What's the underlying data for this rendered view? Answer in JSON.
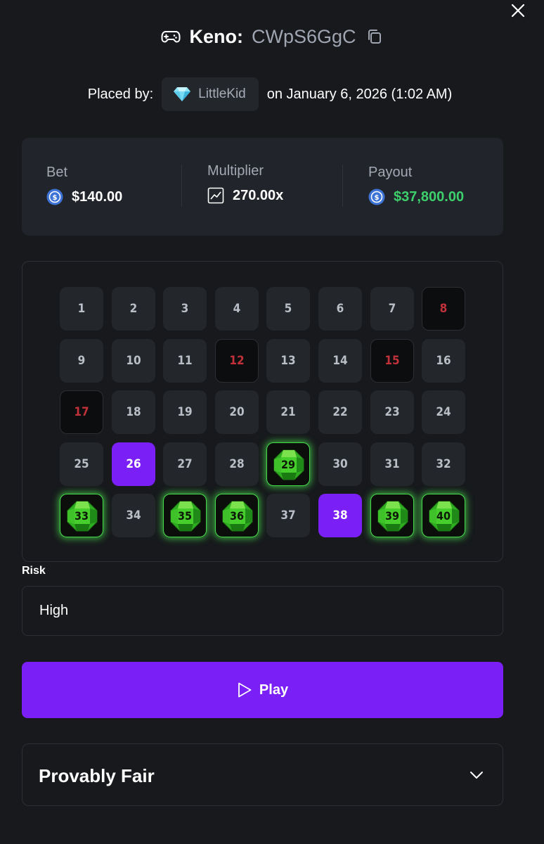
{
  "header": {
    "game_label": "Keno:",
    "bet_id": "CWpS6GgC",
    "game_icon": "gamepad-icon",
    "copy_icon": "copy-icon",
    "close_icon": "close-icon"
  },
  "placed": {
    "label": "Placed by:",
    "user_icon": "diamond-icon",
    "username": "LittleKid",
    "date": "on January 6, 2026 (1:02 AM)"
  },
  "stats": {
    "bet_label": "Bet",
    "bet_value": "$140.00",
    "multiplier_label": "Multiplier",
    "multiplier_value": "270.00x",
    "payout_label": "Payout",
    "payout_value": "$37,800.00",
    "coin_icon": "usd-coin-icon",
    "multiplier_icon": "chart-icon"
  },
  "board": {
    "tiles": [
      {
        "n": "1",
        "state": "normal"
      },
      {
        "n": "2",
        "state": "normal"
      },
      {
        "n": "3",
        "state": "normal"
      },
      {
        "n": "4",
        "state": "normal"
      },
      {
        "n": "5",
        "state": "normal"
      },
      {
        "n": "6",
        "state": "normal"
      },
      {
        "n": "7",
        "state": "normal"
      },
      {
        "n": "8",
        "state": "miss"
      },
      {
        "n": "9",
        "state": "normal"
      },
      {
        "n": "10",
        "state": "normal"
      },
      {
        "n": "11",
        "state": "normal"
      },
      {
        "n": "12",
        "state": "miss"
      },
      {
        "n": "13",
        "state": "normal"
      },
      {
        "n": "14",
        "state": "normal"
      },
      {
        "n": "15",
        "state": "miss"
      },
      {
        "n": "16",
        "state": "normal"
      },
      {
        "n": "17",
        "state": "miss"
      },
      {
        "n": "18",
        "state": "normal"
      },
      {
        "n": "19",
        "state": "normal"
      },
      {
        "n": "20",
        "state": "normal"
      },
      {
        "n": "21",
        "state": "normal"
      },
      {
        "n": "22",
        "state": "normal"
      },
      {
        "n": "23",
        "state": "normal"
      },
      {
        "n": "24",
        "state": "normal"
      },
      {
        "n": "25",
        "state": "normal"
      },
      {
        "n": "26",
        "state": "picked"
      },
      {
        "n": "27",
        "state": "normal"
      },
      {
        "n": "28",
        "state": "normal"
      },
      {
        "n": "29",
        "state": "hit"
      },
      {
        "n": "30",
        "state": "normal"
      },
      {
        "n": "31",
        "state": "normal"
      },
      {
        "n": "32",
        "state": "normal"
      },
      {
        "n": "33",
        "state": "hit"
      },
      {
        "n": "34",
        "state": "normal"
      },
      {
        "n": "35",
        "state": "hit"
      },
      {
        "n": "36",
        "state": "hit"
      },
      {
        "n": "37",
        "state": "normal"
      },
      {
        "n": "38",
        "state": "picked"
      },
      {
        "n": "39",
        "state": "hit"
      },
      {
        "n": "40",
        "state": "hit"
      }
    ]
  },
  "risk": {
    "label": "Risk",
    "value": "High"
  },
  "play": {
    "label": "Play",
    "icon": "play-icon"
  },
  "fair": {
    "title": "Provably Fair",
    "icon": "chevron-down-icon"
  },
  "colors": {
    "background": "#17191c",
    "card": "#21242a",
    "accent": "#7a1ff5",
    "payout_green": "#3ecf6d",
    "miss_red": "#c0313a",
    "gem_green": "#46d84b"
  }
}
